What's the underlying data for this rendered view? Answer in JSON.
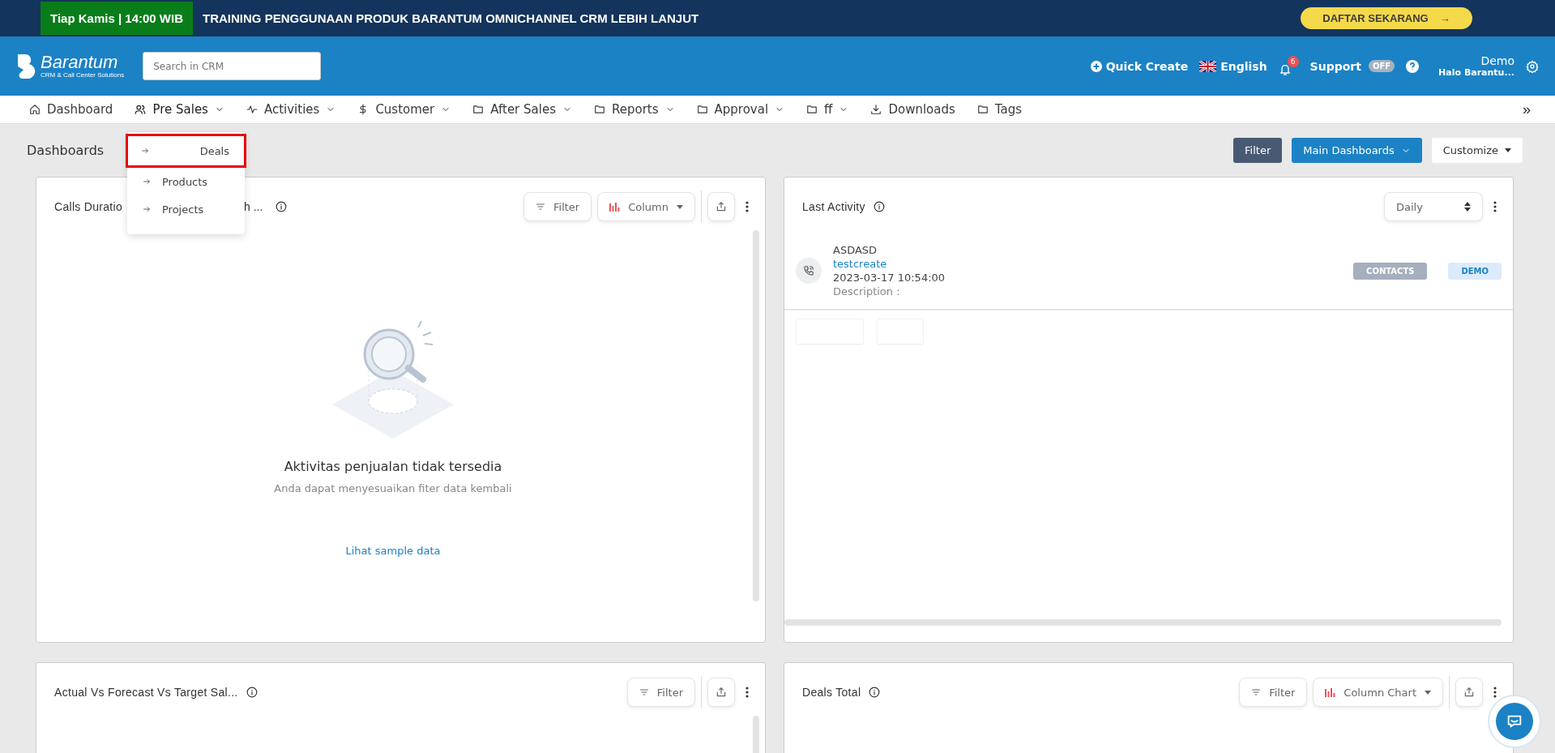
{
  "promo": {
    "badge": "Tiap Kamis | 14:00 WIB",
    "headline": "TRAINING PENGGUNAAN PRODUK BARANTUM OMNICHANNEL CRM LEBIH LANJUT",
    "cta": "DAFTAR SEKARANG",
    "cta_arrow": "→"
  },
  "header": {
    "logo_name": "Barantum",
    "logo_tagline": "CRM & Call Center Solutions",
    "search": {
      "placeholder": "Search in CRM"
    },
    "quick_create": "Quick Create",
    "language": "English",
    "notification_count": "6",
    "support": {
      "label": "Support",
      "toggle": "OFF",
      "on": false
    },
    "user": {
      "name": "Demo",
      "greeting": "Halo Barantu..."
    }
  },
  "nav": {
    "items": [
      {
        "label": "Dashboard",
        "kind": "home",
        "dropdown": false,
        "expanded": false
      },
      {
        "label": "Pre Sales",
        "kind": "users",
        "dropdown": true,
        "expanded": true,
        "menu": [
          {
            "label": "Deals",
            "selected": true
          },
          {
            "label": "Products",
            "selected": false
          },
          {
            "label": "Projects",
            "selected": false
          }
        ]
      },
      {
        "label": "Activities",
        "kind": "pulse",
        "dropdown": true,
        "expanded": false
      },
      {
        "label": "Customer",
        "kind": "dollar",
        "dropdown": true,
        "expanded": false
      },
      {
        "label": "After Sales",
        "kind": "folder",
        "dropdown": true,
        "expanded": false
      },
      {
        "label": "Reports",
        "kind": "folder",
        "dropdown": true,
        "expanded": false
      },
      {
        "label": "Approval",
        "kind": "folder",
        "dropdown": true,
        "expanded": false
      },
      {
        "label": "ff",
        "kind": "folder",
        "dropdown": true,
        "expanded": false
      },
      {
        "label": "Downloads",
        "kind": "download",
        "dropdown": false,
        "expanded": false
      },
      {
        "label": "Tags",
        "kind": "folder",
        "dropdown": false,
        "expanded": false
      }
    ],
    "more": "»"
  },
  "toolbar": {
    "title": "Dashboards",
    "filter": "Filter",
    "dashboard_select": "Main Dashboards",
    "customize": "Customize"
  },
  "widgets": [
    {
      "kind": "empty",
      "title": "Calls Duratio",
      "title_tail": "h ...",
      "controls": [
        {
          "kind": "filter",
          "label": "Filter"
        },
        {
          "kind": "chart_type",
          "label": "Column"
        },
        {
          "kind": "export"
        },
        {
          "kind": "more"
        }
      ],
      "empty": {
        "title": "Aktivitas penjualan tidak tersedia",
        "text": "Anda dapat menyesuaikan fiter data kembali",
        "link": "Lihat sample data"
      }
    },
    {
      "kind": "activity",
      "title": "Last Activity",
      "controls": [
        {
          "kind": "select",
          "label": "Daily"
        },
        {
          "kind": "more"
        }
      ],
      "activities": [
        {
          "name": "ASDASD",
          "link": "testcreate",
          "time": "2023-03-17 10:54:00",
          "description": "Description :",
          "tags": [
            {
              "label": "CONTACTS",
              "color": "#a5afbd"
            },
            {
              "label": "DEMO",
              "color": "#dcebfb"
            }
          ]
        }
      ]
    },
    {
      "kind": "blank",
      "title": "Actual Vs Forecast Vs Target Sal...",
      "controls": [
        {
          "kind": "filter",
          "label": "Filter"
        },
        {
          "kind": "export"
        },
        {
          "kind": "more"
        }
      ]
    },
    {
      "kind": "blank",
      "title": "Deals Total",
      "controls": [
        {
          "kind": "filter",
          "label": "Filter"
        },
        {
          "kind": "chart_type",
          "label": "Column Chart"
        },
        {
          "kind": "export"
        },
        {
          "kind": "more"
        }
      ]
    }
  ]
}
